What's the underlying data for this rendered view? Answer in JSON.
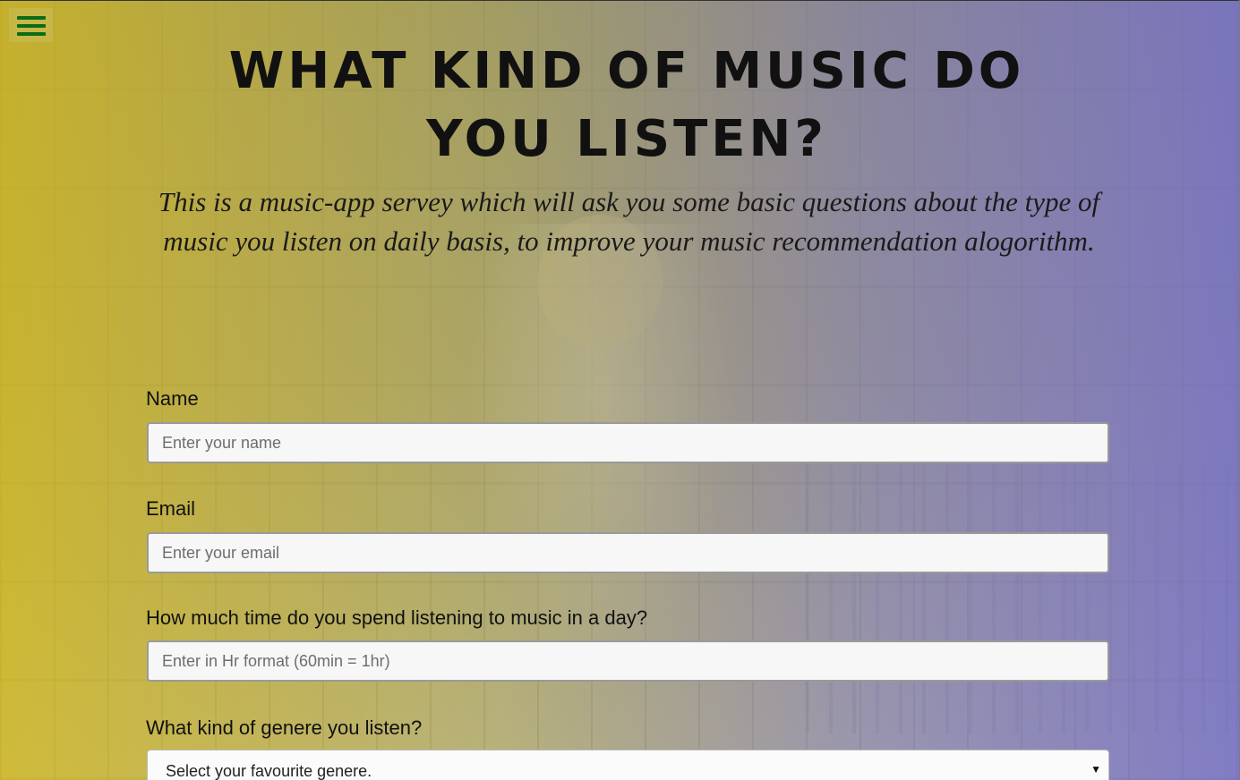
{
  "header": {
    "title": "What kind of music do you listen?",
    "description": "This is a music-app servey which will ask you some basic questions about the type of music you listen on daily basis, to improve your music recommendation alogorithm."
  },
  "form": {
    "name": {
      "label": "Name",
      "placeholder": "Enter your name",
      "value": ""
    },
    "email": {
      "label": "Email",
      "placeholder": "Enter your email",
      "value": ""
    },
    "time": {
      "label": "How much time do you spend listening to music in a day?",
      "placeholder": "Enter in Hr format (60min = 1hr)",
      "value": ""
    },
    "genre": {
      "label": "What kind of genere you listen?",
      "selected": "Select your favourite genere."
    }
  },
  "icons": {
    "menu": "hamburger-menu-icon",
    "dropdown": "triangle-down-icon"
  },
  "colors": {
    "overlay_left": "#d6be28",
    "overlay_right": "#7d78c8",
    "menu_icon": "#0b6b17",
    "title_text": "#111111"
  }
}
